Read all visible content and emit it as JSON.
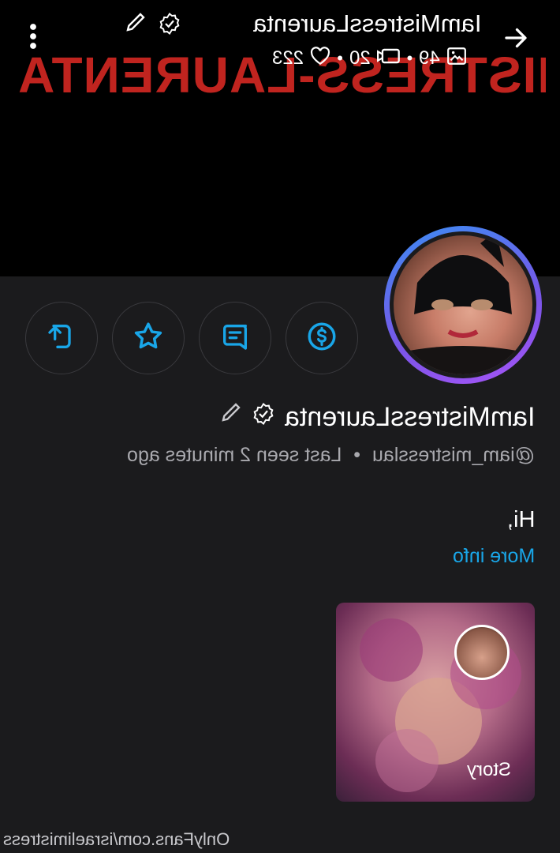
{
  "header": {
    "title": "IamMistressLaurenta",
    "brand_text": "MISTRESS-LAURENTA",
    "stats": {
      "photos": "49",
      "videos": "20",
      "likes": "223"
    },
    "icons": {
      "back": "arrow-right-icon",
      "menu": "kebab-menu-icon",
      "edit": "pencil-icon",
      "verified": "verified-badge-icon"
    }
  },
  "actions": {
    "tip": "dollar-coin-icon",
    "message": "message-icon",
    "favorite": "star-icon",
    "share": "share-icon"
  },
  "profile": {
    "name": "IamMistressLaurenta",
    "handle": "@iam_mistresslau",
    "separator": "•",
    "last_seen": "Last seen 2 minutes ago",
    "bio": "Hi,",
    "more_info": "More info"
  },
  "story": {
    "label": "Story"
  },
  "footer": {
    "url": "OnlyFans.com/israelimistress"
  },
  "colors": {
    "accent": "#19a6e8",
    "brand_red": "#c0241f",
    "background": "#1b1b1d"
  }
}
